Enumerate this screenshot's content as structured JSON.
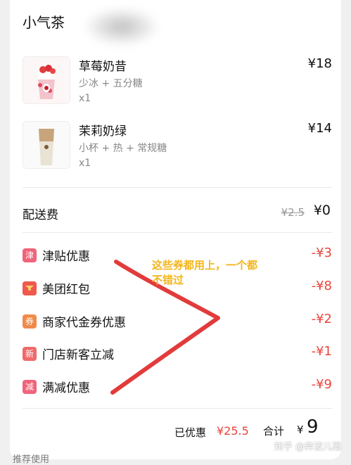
{
  "shop": {
    "name": "小气茶"
  },
  "items": [
    {
      "name": "草莓奶昔",
      "spec": "少冰 + 五分糖",
      "qty": "x1",
      "price": "¥18"
    },
    {
      "name": "茉莉奶绿",
      "spec": "小杯 + 热 + 常规糖",
      "qty": "x1",
      "price": "¥14"
    }
  ],
  "delivery": {
    "label": "配送费",
    "original": "¥2.5",
    "current": "¥0"
  },
  "discounts": [
    {
      "icon_char": "津",
      "icon_color": "#f0647a",
      "label": "津贴优惠",
      "value": "-¥3"
    },
    {
      "icon_char": "",
      "icon_color": "#ef5a4d",
      "label": "美团红包",
      "value": "-¥8"
    },
    {
      "icon_char": "券",
      "icon_color": "#f08a4b",
      "label": "商家代金券优惠",
      "value": "-¥2"
    },
    {
      "icon_char": "新",
      "icon_color": "#ef6a6a",
      "label": "门店新客立减",
      "value": "-¥1"
    },
    {
      "icon_char": "减",
      "icon_color": "#f0647a",
      "label": "满减优惠",
      "value": "-¥9"
    }
  ],
  "annotation": {
    "line1": "这些券都用上，一个都",
    "line2": "不错过"
  },
  "footer": {
    "saved_label": "已优惠",
    "saved_value": "¥25.5",
    "total_label": "合计",
    "total_currency": "¥",
    "total_value": "9"
  },
  "watermark": "知乎 @奔波儿灞",
  "bottom_cut_text": "推荐使用"
}
